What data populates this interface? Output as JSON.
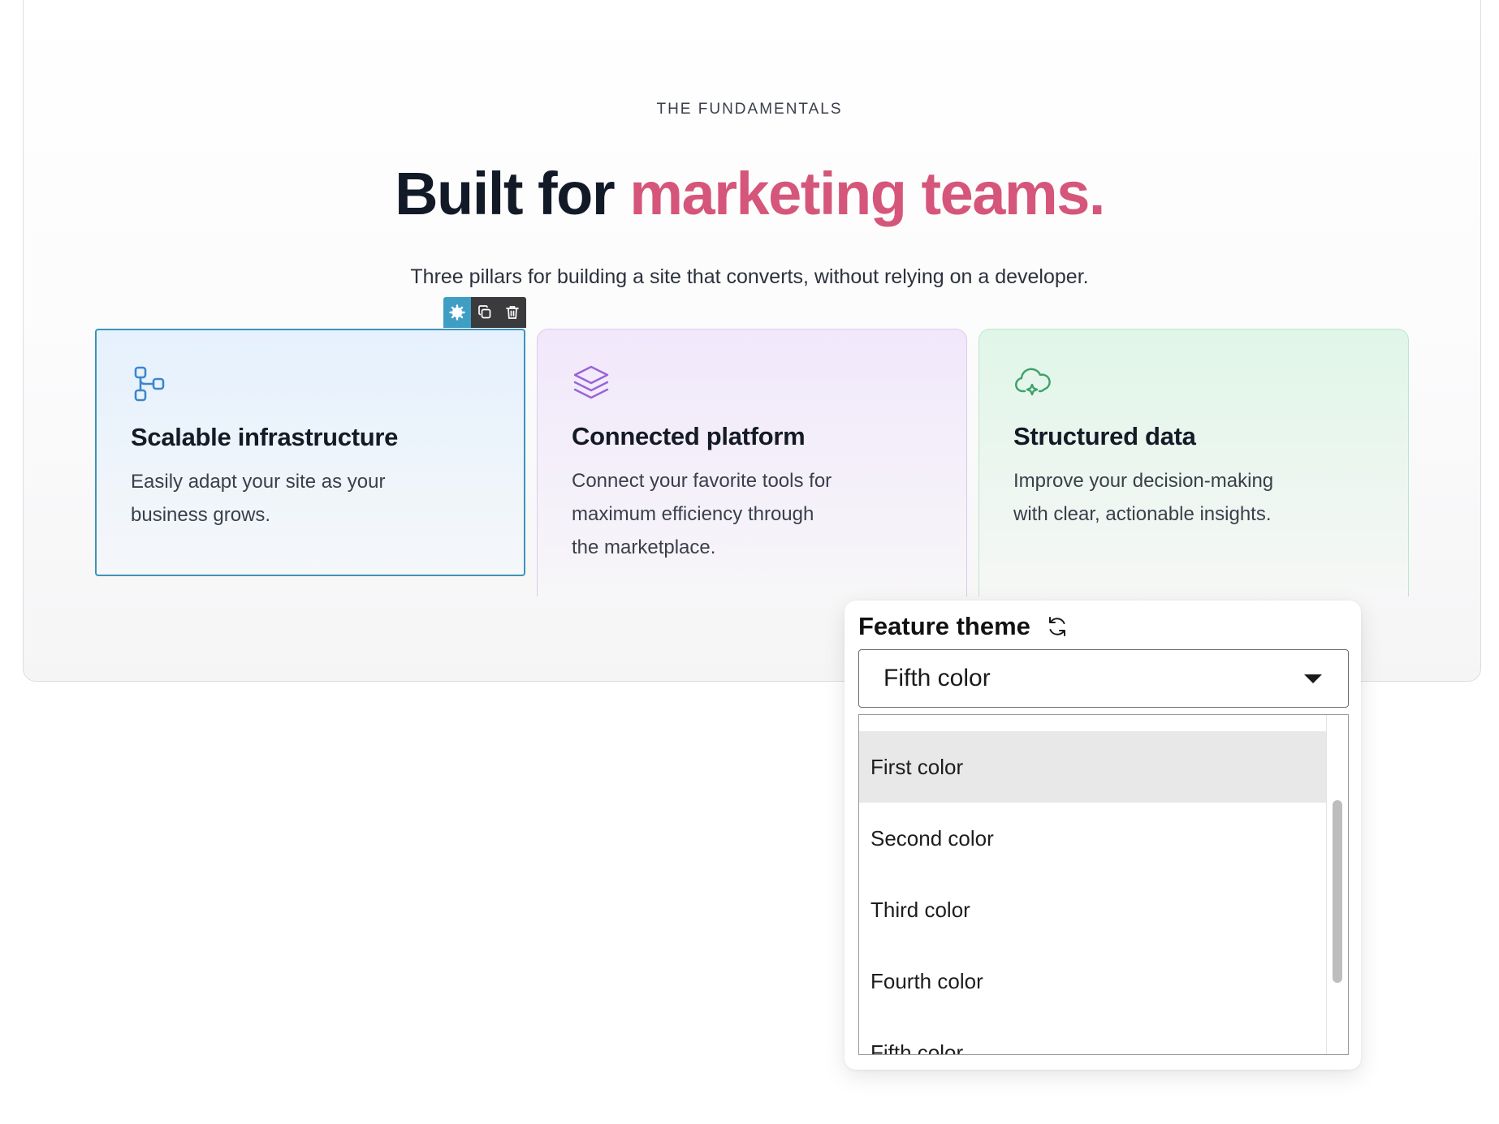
{
  "section": {
    "eyebrow": "THE FUNDAMENTALS",
    "headline_main": "Built for ",
    "headline_accent": "marketing teams.",
    "subhead": "Three pillars for building a site that converts, without relying on a developer."
  },
  "toolbar": {
    "buttons": [
      {
        "icon": "settings-gear-icon"
      },
      {
        "icon": "duplicate-icon"
      },
      {
        "icon": "trash-icon"
      }
    ]
  },
  "cards": [
    {
      "icon": "branch-network-icon",
      "title": "Scalable infrastructure",
      "text": "Easily adapt your site as your business grows.",
      "accent": "#3d86cc"
    },
    {
      "icon": "stacked-layers-icon",
      "title": "Connected platform",
      "text": "Connect your favorite tools for maximum efficiency through the marketplace.",
      "accent": "#9b63d6"
    },
    {
      "icon": "cloud-sparkle-icon",
      "title": "Structured data",
      "text": "Improve your decision-making with clear, actionable insights.",
      "accent": "#3fa06b"
    }
  ],
  "theme_panel": {
    "label": "Feature theme",
    "selected": "Fifth color",
    "options": [
      "First color",
      "Second color",
      "Third color",
      "Fourth color",
      "Fifth color"
    ],
    "highlighted_index": 0
  },
  "colors": {
    "accent_pink": "#d5567a",
    "selection_blue": "#3e93b8",
    "toolbar_dark": "#3b3b3d"
  }
}
